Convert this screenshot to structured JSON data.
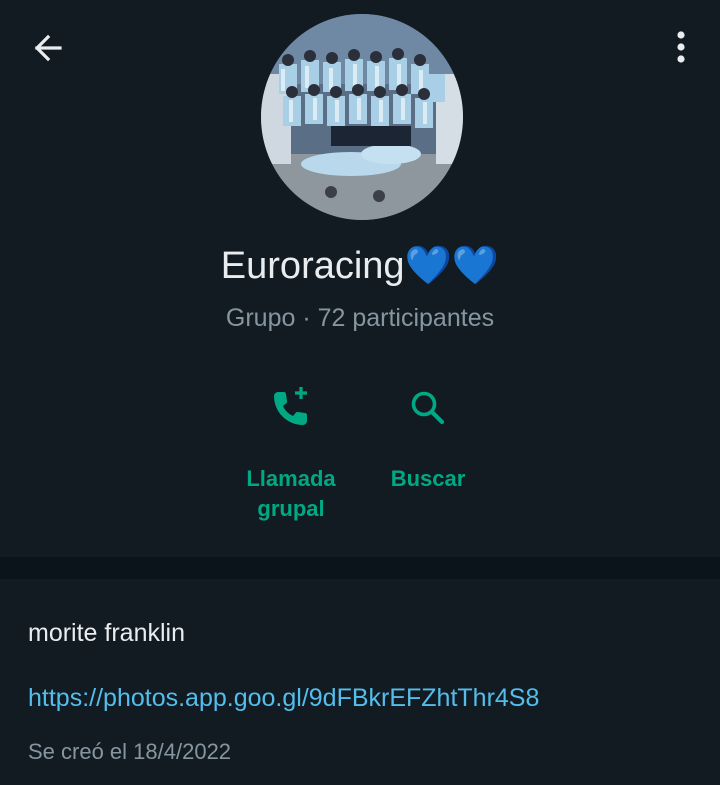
{
  "icons": {
    "back": "arrow-left-icon",
    "menu": "more-vertical-icon",
    "call": "phone-add-icon",
    "search": "search-icon"
  },
  "colors": {
    "background": "#121b22",
    "accent": "#00a884",
    "link": "#53bdeb",
    "secondary_text": "#8696a0",
    "divider": "#0b141a"
  },
  "group": {
    "name": "Euroracing💙💙",
    "subtitle": "Grupo · 72 participantes"
  },
  "actions": [
    {
      "label_line1": "Llamada",
      "label_line2": "grupal"
    },
    {
      "label_line1": "Buscar"
    }
  ],
  "info": {
    "description": "morite franklin",
    "link": "https://photos.app.goo.gl/9dFBkrEFZhtThr4S8",
    "created": "Se creó el 18/4/2022"
  }
}
